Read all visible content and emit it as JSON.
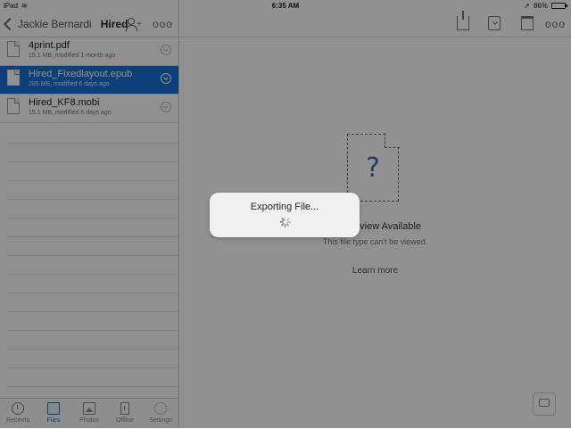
{
  "status_bar": {
    "device": "iPad",
    "wifi_icon": "wifi-icon",
    "time": "6:35 AM",
    "location_icon": "location-arrow-icon",
    "battery_percent": "86%",
    "battery_level": 0.86
  },
  "nav": {
    "back_label": "Jackie Bernardi",
    "title": "Hired",
    "add_user_icon": "add-user-icon",
    "more_icon": "more-icon",
    "more_glyph": "ooo"
  },
  "files": [
    {
      "name": "4print.pdf",
      "meta": "19.1 MB, modified 1 month ago",
      "selected": false
    },
    {
      "name": "Hired_Fixedlayout.epub",
      "meta": "285 MB, modified 6 days ago",
      "selected": true
    },
    {
      "name": "Hired_KF8.mobi",
      "meta": "15.1 MB, modified 6 days ago",
      "selected": false
    }
  ],
  "tabs": [
    {
      "label": "Recents",
      "icon": "clock-icon"
    },
    {
      "label": "Files",
      "icon": "files-icon",
      "active": true
    },
    {
      "label": "Photos",
      "icon": "photos-icon"
    },
    {
      "label": "Offline",
      "icon": "offline-icon"
    },
    {
      "label": "Settings",
      "icon": "gear-icon"
    }
  ],
  "toolbar": {
    "share_icon": "share-icon",
    "download_icon": "download-icon",
    "trash_icon": "trash-icon",
    "more_icon": "more-icon",
    "more_glyph": "ooo"
  },
  "preview": {
    "symbol": "?",
    "title": "No Preview Available",
    "subtitle": "This file type can't be viewed.",
    "learn_more": "Learn more"
  },
  "dialog": {
    "title": "Exporting File..."
  },
  "colors": {
    "accent": "#1770d4",
    "overlay": "rgba(0,0,0,0.43)"
  }
}
